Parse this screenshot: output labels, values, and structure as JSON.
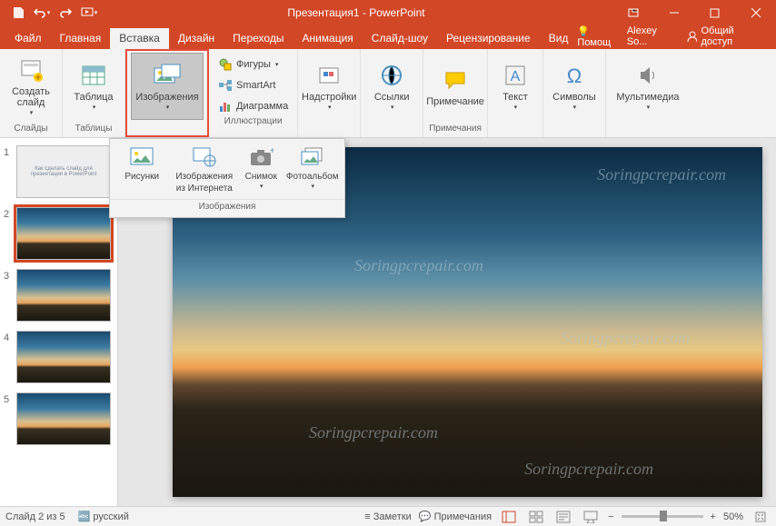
{
  "title": "Презентация1 - PowerPoint",
  "qat": {
    "save": "save-icon",
    "undo": "undo-icon",
    "redo": "redo-icon",
    "start": "start-icon"
  },
  "tabs": {
    "file": "Файл",
    "home": "Главная",
    "insert": "Вставка",
    "design": "Дизайн",
    "transitions": "Переходы",
    "animation": "Анимация",
    "slideshow": "Слайд-шоу",
    "review": "Рецензирование",
    "view": "Вид",
    "help": "Помощ",
    "user": "Alexey So...",
    "share": "Общий доступ"
  },
  "ribbon": {
    "newslide": "Создать слайд",
    "table": "Таблица",
    "images": "Изображения",
    "shapes": "Фигуры",
    "smartart": "SmartArt",
    "chart": "Диаграмма",
    "addins": "Надстройки",
    "links": "Ссылки",
    "comment": "Примечание",
    "text": "Текст",
    "symbols": "Символы",
    "media": "Мультимедиа",
    "g_slides": "Слайды",
    "g_tables": "Таблицы",
    "g_illustrations": "Иллюстрации",
    "g_comments": "Примечания"
  },
  "dropdown": {
    "pictures": "Рисунки",
    "online_l1": "Изображения",
    "online_l2": "из Интернета",
    "screenshot": "Снимок",
    "album": "Фотоальбом",
    "label": "Изображения"
  },
  "thumbs": [
    "1",
    "2",
    "3",
    "4",
    "5"
  ],
  "status": {
    "slide": "Слайд 2 из 5",
    "lang": "русский",
    "notes": "Заметки",
    "comments": "Примечания",
    "zoom": "50%"
  }
}
